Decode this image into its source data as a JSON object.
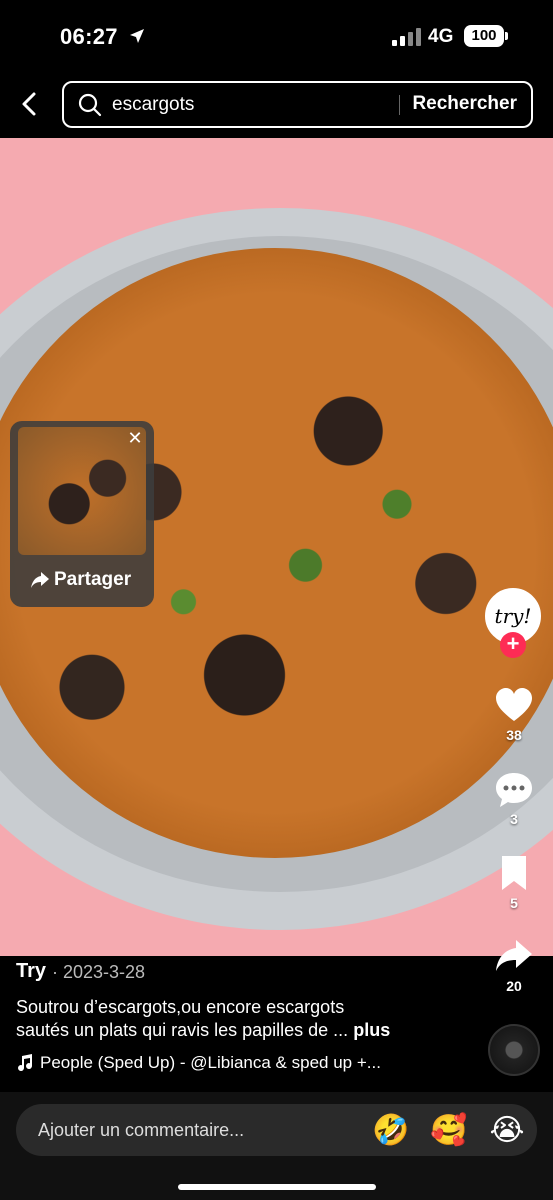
{
  "status_bar": {
    "time": "06:27",
    "network": "4G",
    "battery": "100"
  },
  "search": {
    "query": "escargots",
    "submit_label": "Rechercher"
  },
  "share_popup": {
    "button_label": "Partager"
  },
  "author_avatar": {
    "text": "try!"
  },
  "actions": {
    "likes": "38",
    "comments": "3",
    "saves": "5",
    "shares": "20"
  },
  "post": {
    "author": "Try",
    "date": "· 2023-3-28",
    "caption_line1": "Soutrou d’escargots,ou encore escargots",
    "caption_line2": "sautés un plats qui ravis les papilles de ...",
    "more_label": "plus",
    "music": "People (Sped Up) - @Libianca & sped up +..."
  },
  "comment_bar": {
    "placeholder": "Ajouter un commentaire...",
    "emojis": [
      "🤣",
      "🥰",
      "😭"
    ]
  },
  "colors": {
    "background": "#000000",
    "video_background": "#f5aab0",
    "follow_accent": "#fe2c55"
  }
}
